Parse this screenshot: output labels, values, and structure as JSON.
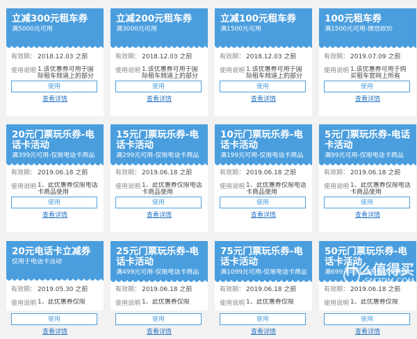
{
  "labels": {
    "validity": "有效期：",
    "instructions": "使用说明",
    "use_button": "使用",
    "detail_link": "查看详情"
  },
  "coupons": [
    {
      "title": "立减300元租车券",
      "subtitle": "满5000元可用",
      "validity": "2018.12.03 之前",
      "desc": "1.该优惠券可用于国际租车频道上的部分"
    },
    {
      "title": "立减200元租车券",
      "subtitle": "满3000元可用",
      "validity": "2018.12.03 之前",
      "desc": "1.该优惠券可用于国际租车频道上的部分"
    },
    {
      "title": "立减100元租车券",
      "subtitle": "满1500元可用",
      "validity": "2018.12.03 之前",
      "desc": "1.该优惠券可用于国际租车频道上的部分"
    },
    {
      "title": "100元租车券",
      "subtitle": "满1500元可用-微信砍价",
      "validity": "2019.07.09 之前",
      "desc": "1.该优惠券可用于购买租车官网上所有"
    },
    {
      "title": "20元门票玩乐券-电话卡活动",
      "subtitle": "满399元可用-仅限电话卡商品",
      "validity": "2019.06.18 之前",
      "desc": "1、此优惠券仅限电话卡商品使用"
    },
    {
      "title": "15元门票玩乐券-电话卡活动",
      "subtitle": "满299元可用-仅限电话卡商品",
      "validity": "2019.06.18 之前",
      "desc": "1、此优惠券仅限电话卡商品使用"
    },
    {
      "title": "10元门票玩乐券-电话卡活动",
      "subtitle": "满199元可用-仅限电话卡商品",
      "validity": "2019.06.18 之前",
      "desc": "1、此优惠券仅限电话卡商品使用"
    },
    {
      "title": "5元门票玩乐券-电话卡活动",
      "subtitle": "满99元可用-仅限电话卡商品",
      "validity": "2019.06.18 之前",
      "desc": "1、此优惠券仅限电话卡商品使用"
    },
    {
      "title": "20元电话卡立减券",
      "subtitle": "仅用于电话卡活动",
      "validity": "2019.05.30 之前",
      "desc": "1、此优惠券仅限"
    },
    {
      "title": "25元门票玩乐券-电话卡活动",
      "subtitle": "满499元可用-仅限电话卡商品",
      "validity": "2019.06.18 之前",
      "desc": "1、此优惠券仅限"
    },
    {
      "title": "75元门票玩乐券-电话卡活动",
      "subtitle": "满1099元可用-仅限电话卡商品",
      "validity": "2019.06.18 之前",
      "desc": "1、此优惠券仅限"
    },
    {
      "title": "50元门票玩乐券-电话卡活动",
      "subtitle": "满699元可用-仅限电话卡商品",
      "validity": "2019.06.18 之前",
      "desc": "1、此优惠券仅限"
    }
  ],
  "watermark": {
    "main": "什么值得买",
    "sub": "SMZDM.COM"
  },
  "colors": {
    "accent": "#4a9ede",
    "link": "#2b78c5",
    "background": "#f2f2f2"
  }
}
